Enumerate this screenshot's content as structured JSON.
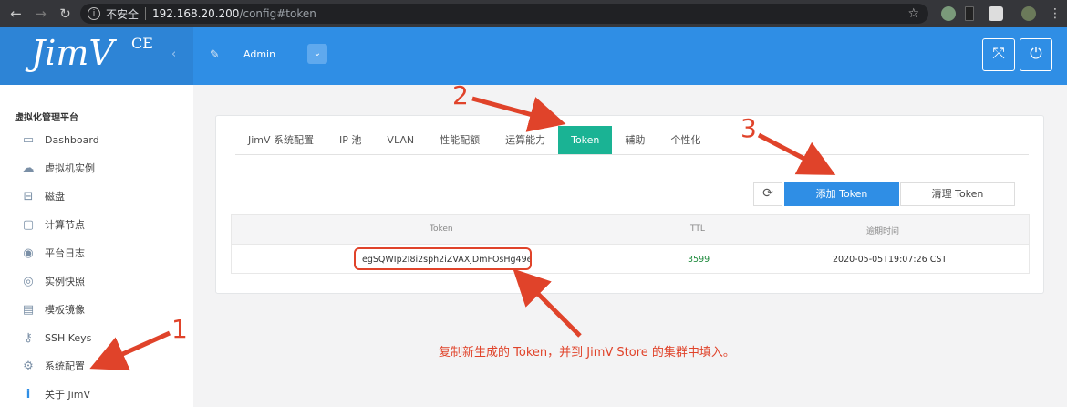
{
  "browser": {
    "insecure_label": "不安全",
    "url_host": "192.168.20.200",
    "url_path": "/config#token"
  },
  "app": {
    "logo": "JimV",
    "logo_sup": "CE",
    "user_name": "Admin"
  },
  "sidebar": {
    "title": "虚拟化管理平台",
    "items": [
      {
        "label": "Dashboard",
        "icon": "dashboard-icon"
      },
      {
        "label": "虚拟机实例",
        "icon": "cloud-icon"
      },
      {
        "label": "磁盘",
        "icon": "disk-icon"
      },
      {
        "label": "计算节点",
        "icon": "monitor-icon"
      },
      {
        "label": "平台日志",
        "icon": "eye-icon"
      },
      {
        "label": "实例快照",
        "icon": "camera-icon"
      },
      {
        "label": "模板镜像",
        "icon": "template-icon"
      },
      {
        "label": "SSH Keys",
        "icon": "key-icon"
      },
      {
        "label": "系统配置",
        "icon": "gear-icon"
      },
      {
        "label": "关于 JimV",
        "icon": "info-icon"
      }
    ]
  },
  "tabs": [
    {
      "label": "JimV 系统配置"
    },
    {
      "label": "IP 池"
    },
    {
      "label": "VLAN"
    },
    {
      "label": "性能配额"
    },
    {
      "label": "运算能力"
    },
    {
      "label": "Token",
      "active": true
    },
    {
      "label": "辅助"
    },
    {
      "label": "个性化"
    }
  ],
  "toolbar": {
    "add_label": "添加 Token",
    "clear_label": "清理 Token"
  },
  "table": {
    "columns": [
      "Token",
      "TTL",
      "逾期时间"
    ],
    "rows": [
      {
        "token": "egSQWIp2I8i2sph2iZVAXjDmFOsHg49e",
        "ttl": "3599",
        "expires": "2020-05-05T19:07:26 CST"
      }
    ]
  },
  "annotations": {
    "step1": "1",
    "step2": "2",
    "step3": "3",
    "caption": "复制新生成的 Token，并到 JimV Store 的集群中填入。",
    "color": "#e0432a"
  }
}
